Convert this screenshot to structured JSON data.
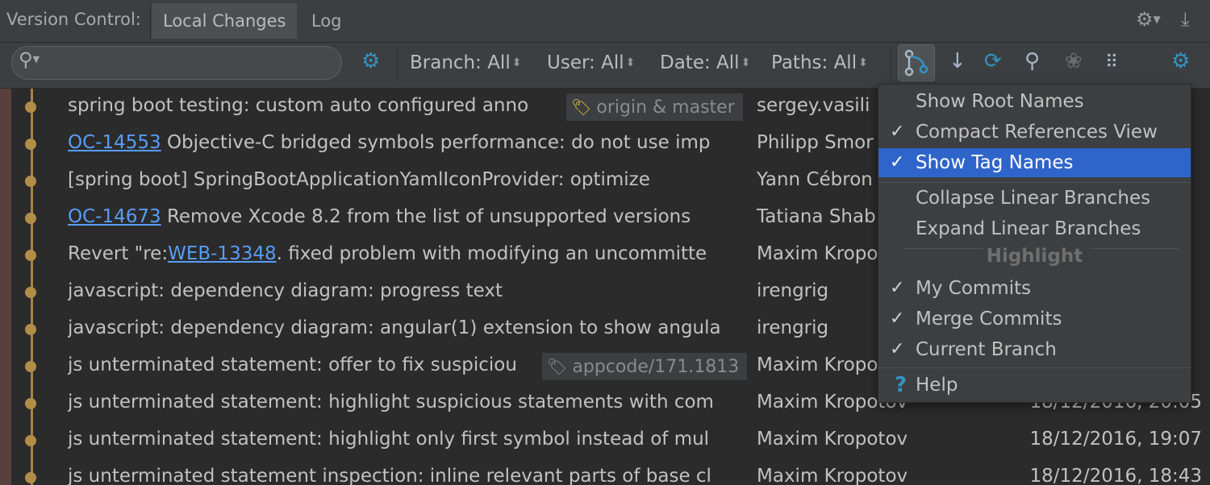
{
  "tabbar": {
    "title": "Version Control:",
    "tabs": [
      {
        "label": "Local Changes"
      },
      {
        "label": "Log"
      }
    ]
  },
  "toolbar": {
    "search_placeholder": "",
    "filters": [
      {
        "label": "Branch: All"
      },
      {
        "label": "User: All"
      },
      {
        "label": "Date: All"
      },
      {
        "label": "Paths: All"
      }
    ]
  },
  "commits": [
    {
      "subject": "spring boot testing: custom auto configured anno",
      "ref": "origin & master",
      "author": "sergey.vasili",
      "date": ""
    },
    {
      "link": "OC-14553",
      "subject": " Objective-C bridged symbols performance: do not use imp",
      "author": "Philipp Smor",
      "date": ""
    },
    {
      "subject": "[spring boot] SpringBootApplicationYamlIconProvider: optimize",
      "author": "Yann Cébron",
      "date": ""
    },
    {
      "link": "OC-14673",
      "subject": " Remove Xcode 8.2 from the list of unsupported versions",
      "author": "Tatiana Shab",
      "date": ""
    },
    {
      "prefix": "Revert \"re:",
      "link": "WEB-13348",
      "subject": ". fixed problem with modifying an uncommitte",
      "author": "Maxim Kropo",
      "date": ""
    },
    {
      "subject": "javascript: dependency diagram: progress text",
      "author": "irengrig",
      "date": ""
    },
    {
      "subject": "javascript: dependency diagram: angular(1) extension to show angula",
      "author": "irengrig",
      "date": ""
    },
    {
      "subject": "js unterminated statement: offer to fix suspiciou",
      "ref": "appcode/171.1813",
      "author": "Maxim Kropo",
      "date": ""
    },
    {
      "subject": "js unterminated statement: highlight suspicious statements with com",
      "author": "Maxim Kropotov",
      "date": "18/12/2016, 20:05"
    },
    {
      "subject": "js unterminated statement: highlight only first symbol instead of mul",
      "author": "Maxim Kropotov",
      "date": "18/12/2016, 19:07"
    },
    {
      "subject": "js unterminated statement inspection: inline relevant parts of base cl",
      "author": "Maxim Kropotov",
      "date": "18/12/2016, 18:43"
    }
  ],
  "popup": {
    "items": [
      {
        "label": "Show Root Names",
        "checked": false
      },
      {
        "label": "Compact References View",
        "checked": true
      },
      {
        "label": "Show Tag Names",
        "checked": true,
        "selected": true
      },
      {
        "label": "Collapse Linear Branches",
        "checked": false
      },
      {
        "label": "Expand Linear Branches",
        "checked": false
      }
    ],
    "highlight_header": "Highlight",
    "highlight_items": [
      {
        "label": "My Commits",
        "checked": true
      },
      {
        "label": "Merge Commits",
        "checked": true
      },
      {
        "label": "Current Branch",
        "checked": true
      }
    ],
    "help_label": "Help"
  },
  "colors": {
    "accent": "#3592c4",
    "selection": "#2f65ca",
    "graph": "#b28d48",
    "link": "#589df6"
  }
}
